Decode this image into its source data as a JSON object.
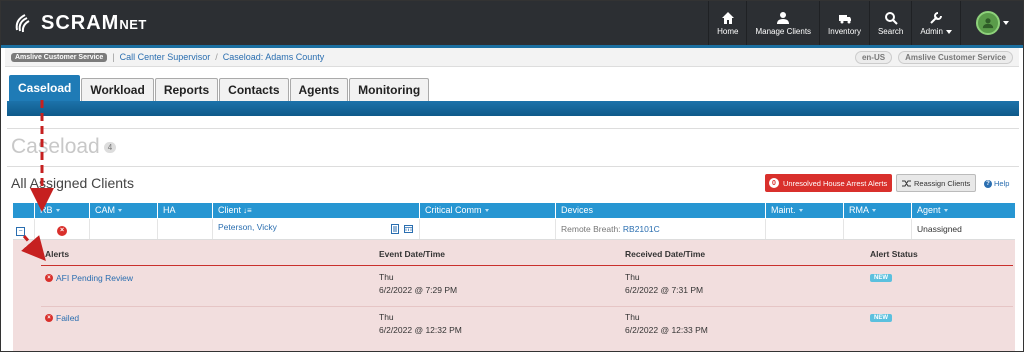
{
  "brand": {
    "name": "SCRAM",
    "suffix": "NET"
  },
  "nav": [
    {
      "label": "Home",
      "icon": "home-icon"
    },
    {
      "label": "Manage Clients",
      "icon": "user-icon"
    },
    {
      "label": "Inventory",
      "icon": "truck-icon"
    },
    {
      "label": "Search",
      "icon": "search-icon"
    },
    {
      "label": "Admin",
      "icon": "wrench-icon"
    }
  ],
  "breadcrumb": {
    "org_pill": "Amslive Customer Service",
    "items": [
      "Call Center Supervisor",
      "Caseload: Adams County"
    ],
    "locale": "en-US",
    "org_right": "Amslive Customer Service"
  },
  "tabs": [
    "Caseload",
    "Workload",
    "Reports",
    "Contacts",
    "Agents",
    "Monitoring"
  ],
  "page": {
    "title": "Caseload",
    "count": "4"
  },
  "section": {
    "title": "All Assigned Clients",
    "alerts_count": "0",
    "alerts_button": "Unresolved House Arrest Alerts",
    "reassign_button": "Reassign Clients",
    "help_label": "Help"
  },
  "table": {
    "columns": [
      "RB",
      "CAM",
      "HA",
      "Client",
      "Critical Comm",
      "Devices",
      "Maint.",
      "RMA",
      "Agent"
    ],
    "row": {
      "client": "Peterson, Vicky",
      "device_prefix": "Remote Breath: ",
      "device_link": "RB2101C",
      "agent": "Unassigned"
    }
  },
  "alerts": {
    "headers": [
      "Alerts",
      "Event Date/Time",
      "Received Date/Time",
      "Alert Status"
    ],
    "rows": [
      {
        "name": "AFI Pending Review",
        "event_day": "Thu",
        "event_dt": "6/2/2022 @ 7:29 PM",
        "recv_day": "Thu",
        "recv_dt": "6/2/2022 @ 7:31 PM",
        "status": "NEW"
      },
      {
        "name": "Failed",
        "event_day": "Thu",
        "event_dt": "6/2/2022 @ 12:32 PM",
        "recv_day": "Thu",
        "recv_dt": "6/2/2022 @ 12:33 PM",
        "status": "NEW"
      }
    ]
  }
}
